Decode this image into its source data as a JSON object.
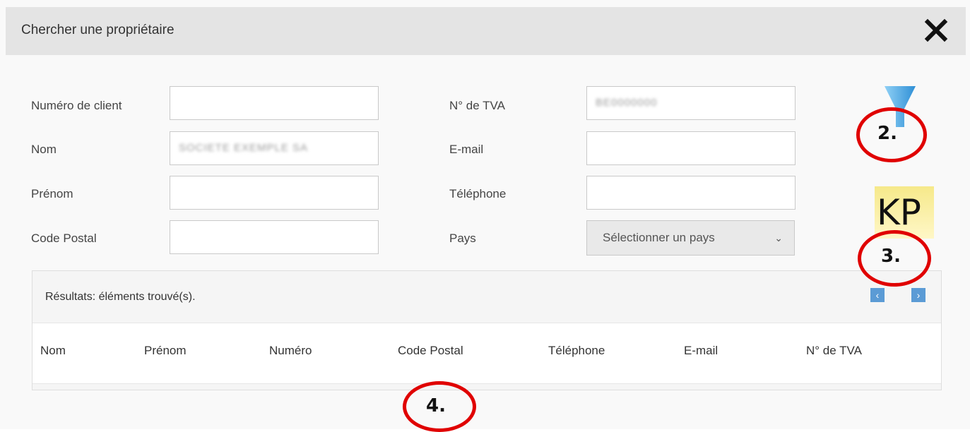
{
  "dialog": {
    "title": "Chercher une propriétaire"
  },
  "form": {
    "client_number": {
      "label": "Numéro de client",
      "value": ""
    },
    "last_name": {
      "label": "Nom",
      "value": "SOCIETE EXEMPLE SA"
    },
    "first_name": {
      "label": "Prénom",
      "value": ""
    },
    "postal_code": {
      "label": "Code Postal",
      "value": ""
    },
    "vat_number": {
      "label": "N° de TVA",
      "value": "BE0000000"
    },
    "email": {
      "label": "E-mail",
      "value": ""
    },
    "phone": {
      "label": "Téléphone",
      "value": ""
    },
    "country": {
      "label": "Pays",
      "selected": "Sélectionner un pays"
    }
  },
  "results": {
    "summary": "Résultats: éléments trouvé(s).",
    "columns": [
      "Nom",
      "Prénom",
      "Numéro",
      "Code Postal",
      "Téléphone",
      "E-mail",
      "N° de TVA"
    ],
    "prev_label": "‹",
    "next_label": "›"
  },
  "toolbar": {
    "kp_label": "KP"
  },
  "annotations": {
    "two": "2.",
    "three": "3.",
    "four": "4."
  },
  "colors": {
    "annotation": "#e00000",
    "pager": "#5b9bd5",
    "filter_icon": "#4aa3df",
    "kp_badge": "#f3e36a"
  }
}
